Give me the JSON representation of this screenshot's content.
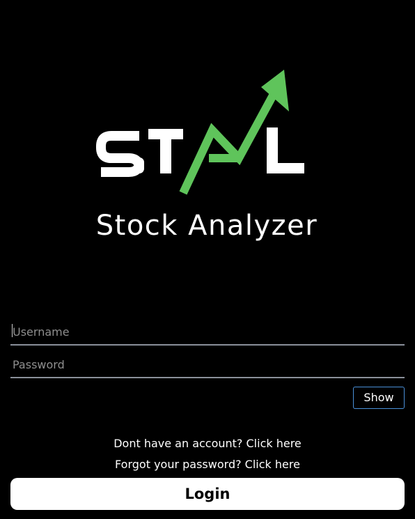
{
  "logo": {
    "wordmark": "STAL",
    "tagline": "Stock Analyzer",
    "accent_color": "#5fc45b",
    "icon": "stock-up-arrow-icon"
  },
  "form": {
    "username_placeholder": "Username",
    "password_placeholder": "Password",
    "username_value": "",
    "password_value": "",
    "show_label": "Show"
  },
  "links": {
    "signup": "Dont have an account? Click here",
    "forgot": "Forgot your password? Click here"
  },
  "login_label": "Login",
  "colors": {
    "background": "#000000",
    "underline": "#8a909a",
    "show_border": "#4a90d9",
    "login_bg": "#ffffff"
  }
}
